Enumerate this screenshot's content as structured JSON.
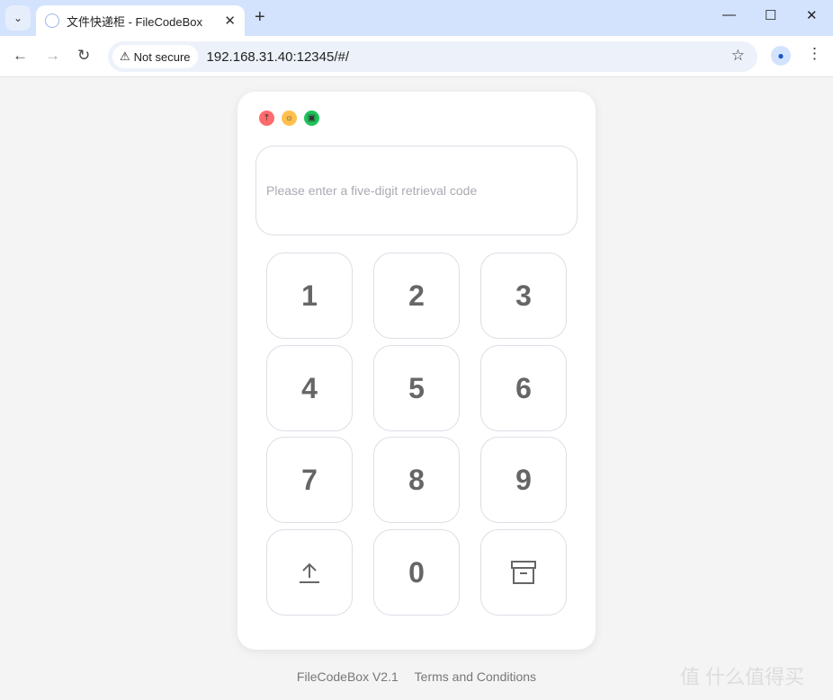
{
  "browser": {
    "tab_title": "文件快递柜 - FileCodeBox",
    "new_tab": "+",
    "not_secure": "Not secure",
    "url": "192.168.31.40:12345/#/"
  },
  "app": {
    "header_icons": [
      {
        "name": "upload-icon",
        "color": "#ff6b6b"
      },
      {
        "name": "sun-icon",
        "color": "#ffc04d"
      },
      {
        "name": "archive-icon",
        "color": "#1ec35b"
      }
    ],
    "code_placeholder": "Please enter a five-digit retrieval code",
    "keys": [
      "1",
      "2",
      "3",
      "4",
      "5",
      "6",
      "7",
      "8",
      "9",
      "upload",
      "0",
      "archive"
    ]
  },
  "footer": {
    "version": "FileCodeBox V2.1",
    "terms": "Terms and Conditions"
  },
  "watermark": "值 什么值得买"
}
